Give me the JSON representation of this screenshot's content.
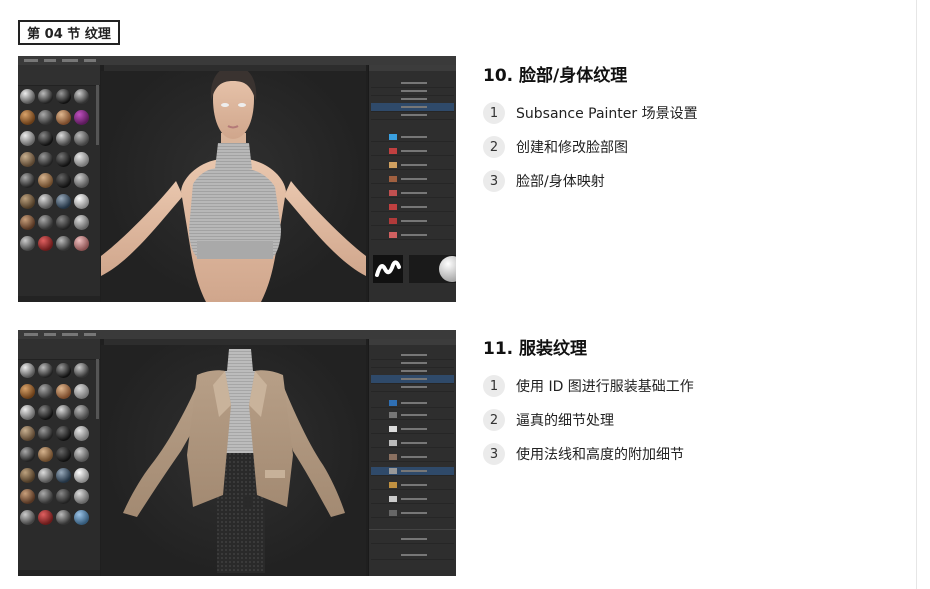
{
  "section_tag": "第 04 节 纹理",
  "lessons": [
    {
      "title": "10. 脸部/身体纹理",
      "items": [
        {
          "num": "1",
          "text": "Subsance Painter 场景设置"
        },
        {
          "num": "2",
          "text": "创建和修改脸部图"
        },
        {
          "num": "3",
          "text": "脸部/身体映射"
        }
      ]
    },
    {
      "title": "11. 服装纹理",
      "items": [
        {
          "num": "1",
          "text": "使用 ID 图进行服装基础工作"
        },
        {
          "num": "2",
          "text": "逼真的细节处理"
        },
        {
          "num": "3",
          "text": "使用法线和高度的附加细节"
        }
      ]
    }
  ],
  "colors": {
    "accent_blue": "#2f6fb3",
    "number_badge_bg": "#ebebeb",
    "app_bg": "#1f1f1f"
  },
  "screenshots": [
    {
      "subject": "female-model-crop-top"
    },
    {
      "subject": "female-model-blazer"
    }
  ]
}
